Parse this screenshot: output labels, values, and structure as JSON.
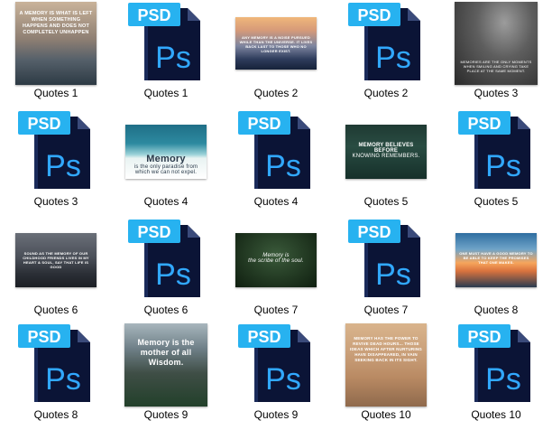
{
  "items": [
    {
      "label": "Quotes 1",
      "type": "image",
      "thumb_text": "A memory is what is left when something happens and does not completely unhappen",
      "scene": "beach"
    },
    {
      "label": "Quotes 1",
      "type": "psd",
      "icon_badge": "PSD",
      "icon_letters": "Ps"
    },
    {
      "label": "Quotes 2",
      "type": "image",
      "thumb_text": "Any memory is a noise pursued while than the universe. It lives back last to those who no longer exist.",
      "scene": "dusk"
    },
    {
      "label": "Quotes 2",
      "type": "psd",
      "icon_badge": "PSD",
      "icon_letters": "Ps"
    },
    {
      "label": "Quotes 3",
      "type": "image",
      "thumb_text": "Memories are the only moments when smiling and crying take place at the same moment.",
      "scene": "portrait"
    },
    {
      "label": "Quotes 3",
      "type": "psd",
      "icon_badge": "PSD",
      "icon_letters": "Ps"
    },
    {
      "label": "Quotes 4",
      "type": "image",
      "thumb_title": "Memory",
      "thumb_text": "is the only paradise from which we can not expel.",
      "scene": "ocean"
    },
    {
      "label": "Quotes 4",
      "type": "psd",
      "icon_badge": "PSD",
      "icon_letters": "Ps"
    },
    {
      "label": "Quotes 5",
      "type": "image",
      "thumb_title": "Memory believes before",
      "thumb_text": "knowing remembers.",
      "scene": "forest"
    },
    {
      "label": "Quotes 5",
      "type": "psd",
      "icon_badge": "PSD",
      "icon_letters": "Ps"
    },
    {
      "label": "Quotes 6",
      "type": "image",
      "thumb_text": "Sound as the memory of our childhood friends lives in my heart & soul, say that life is good",
      "scene": "mountains"
    },
    {
      "label": "Quotes 6",
      "type": "psd",
      "icon_badge": "PSD",
      "icon_letters": "Ps"
    },
    {
      "label": "Quotes 7",
      "type": "image",
      "thumb_title": "Memory is",
      "thumb_text": "the scribe of the soul.",
      "scene": "greenwood"
    },
    {
      "label": "Quotes 7",
      "type": "psd",
      "icon_badge": "PSD",
      "icon_letters": "Ps"
    },
    {
      "label": "Quotes 8",
      "type": "image",
      "thumb_text": "One must have a good memory to be able to keep the promises that one makes.",
      "scene": "sunset"
    },
    {
      "label": "Quotes 8",
      "type": "psd",
      "icon_badge": "PSD",
      "icon_letters": "Ps"
    },
    {
      "label": "Quotes 9",
      "type": "image",
      "thumb_text": "Memory is the mother of all Wisdom.",
      "scene": "peak"
    },
    {
      "label": "Quotes 9",
      "type": "psd",
      "icon_badge": "PSD",
      "icon_letters": "Ps"
    },
    {
      "label": "Quotes 10",
      "type": "image",
      "thumb_text": "Memory has the power to revive dead hours... those ideas which after nurturing have disappeared, in vain seeking back in its sight.",
      "scene": "desert"
    },
    {
      "label": "Quotes 10",
      "type": "psd",
      "icon_badge": "PSD",
      "icon_letters": "Ps"
    }
  ],
  "colors": {
    "psd_body": "#0b1436",
    "psd_badge": "#27b2f0",
    "psd_letters": "#31a8ff",
    "label_text": "#000000"
  }
}
